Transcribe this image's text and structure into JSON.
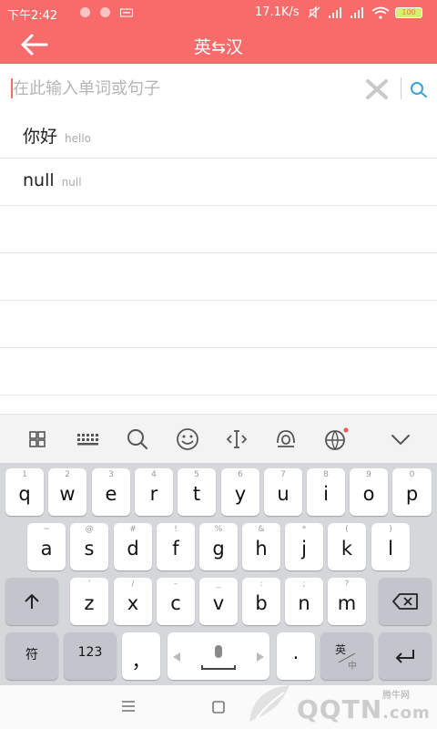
{
  "status_bar": {
    "time": "下午2:42",
    "network_speed": "17.1K/s",
    "battery": "100"
  },
  "header": {
    "title": "英⇆汉",
    "back_icon": "arrow-left-icon"
  },
  "search": {
    "placeholder": "在此输入单词或句子",
    "value": ""
  },
  "results": [
    {
      "word": "你好",
      "sub": "hello"
    },
    {
      "word": "null",
      "sub": "null"
    }
  ],
  "keyboard": {
    "row1": [
      {
        "label": "q",
        "hint": "1"
      },
      {
        "label": "w",
        "hint": "2"
      },
      {
        "label": "e",
        "hint": "3"
      },
      {
        "label": "r",
        "hint": "4"
      },
      {
        "label": "t",
        "hint": "5"
      },
      {
        "label": "y",
        "hint": "6"
      },
      {
        "label": "u",
        "hint": "7"
      },
      {
        "label": "i",
        "hint": "8"
      },
      {
        "label": "o",
        "hint": "9"
      },
      {
        "label": "p",
        "hint": "0"
      }
    ],
    "row2": [
      {
        "label": "a",
        "hint": "~"
      },
      {
        "label": "s",
        "hint": "@"
      },
      {
        "label": "d",
        "hint": "#"
      },
      {
        "label": "f",
        "hint": "!"
      },
      {
        "label": "g",
        "hint": "%"
      },
      {
        "label": "h",
        "hint": "&"
      },
      {
        "label": "j",
        "hint": "*"
      },
      {
        "label": "k",
        "hint": "("
      },
      {
        "label": "l",
        "hint": ")"
      }
    ],
    "row3": [
      {
        "label": "z",
        "hint": "’"
      },
      {
        "label": "x",
        "hint": "/"
      },
      {
        "label": "c",
        "hint": "–"
      },
      {
        "label": "v",
        "hint": "_"
      },
      {
        "label": "b",
        "hint": ":"
      },
      {
        "label": "n",
        "hint": ";"
      },
      {
        "label": "m",
        "hint": "?"
      }
    ],
    "symbols_label": "符",
    "numbers_label": "123",
    "comma_label": "，",
    "period_label": "·",
    "lang_label_top": "英",
    "lang_label_bottom": "中"
  },
  "watermark": {
    "text": "QQTN",
    "small": "腾牛网",
    "suffix": ".com"
  }
}
